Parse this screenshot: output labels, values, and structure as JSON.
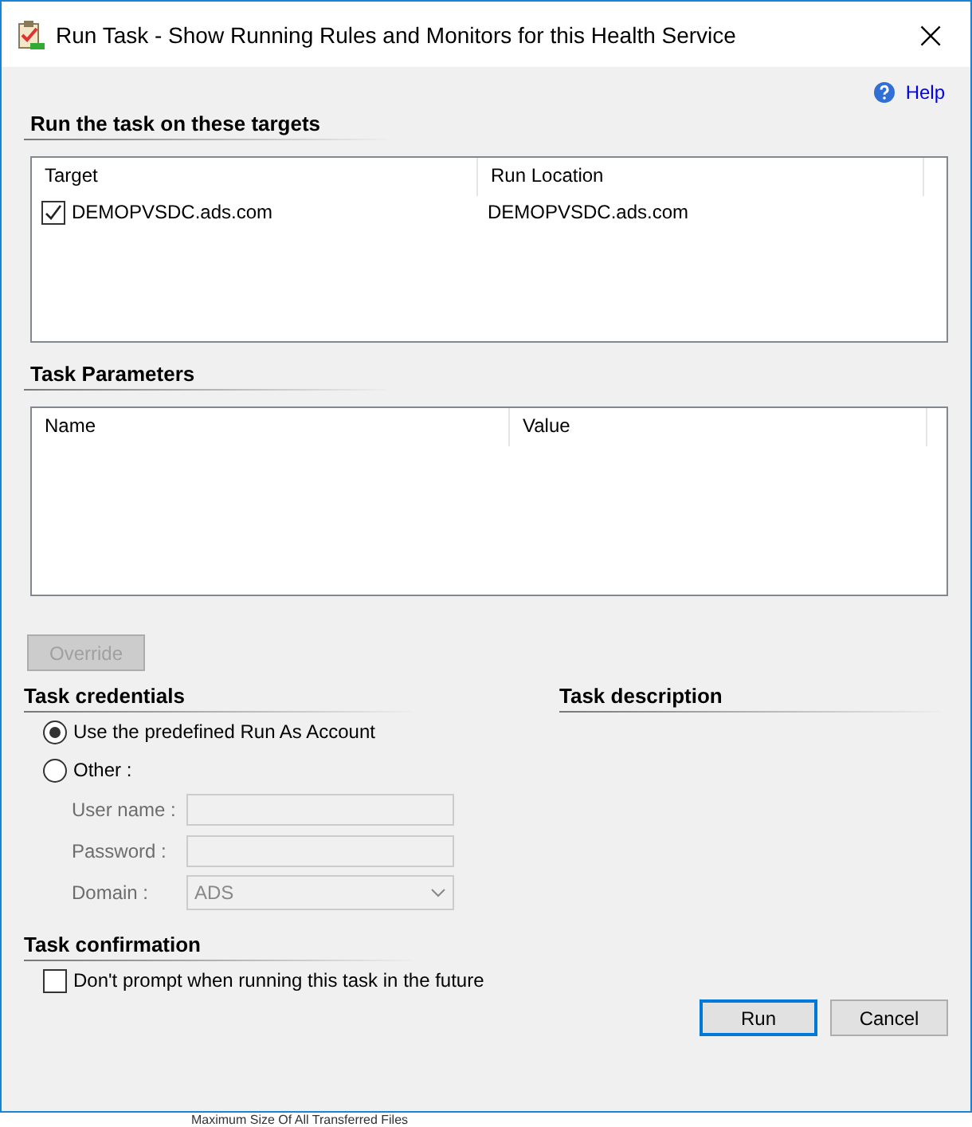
{
  "window": {
    "title": "Run Task - Show Running Rules and Monitors for this Health Service",
    "close": "×"
  },
  "help_link": "Help",
  "targets": {
    "heading": "Run the task on these targets",
    "columns": [
      "Target",
      "Run Location"
    ],
    "rows": [
      {
        "checked": true,
        "cells": [
          "DEMOPVSDC.ads.com",
          "DEMOPVSDC.ads.com"
        ]
      }
    ]
  },
  "parameters": {
    "heading": "Task Parameters",
    "columns": [
      "Name",
      "Value"
    ]
  },
  "override_button": {
    "label": "Override",
    "disabled": true
  },
  "credentials": {
    "heading": "Task credentials",
    "options": [
      {
        "label": "Use the predefined Run As Account",
        "selected": true
      },
      {
        "label": "Other :",
        "selected": false
      }
    ],
    "fields": [
      {
        "label": "User name :",
        "kind": "text",
        "disabled": true
      },
      {
        "label": "Password :",
        "kind": "text",
        "disabled": true
      },
      {
        "label": "Domain :",
        "kind": "select",
        "value": "ADS",
        "disabled": true
      }
    ]
  },
  "description": {
    "heading": "Task description"
  },
  "confirmation": {
    "heading": "Task confirmation",
    "checkbox": {
      "label": "Don't prompt when running this task in the future",
      "checked": false
    }
  },
  "buttons": [
    {
      "label": "Run",
      "default": true
    },
    {
      "label": "Cancel",
      "default": false
    }
  ],
  "background_text": "Maximum Size Of All Transferred Files"
}
